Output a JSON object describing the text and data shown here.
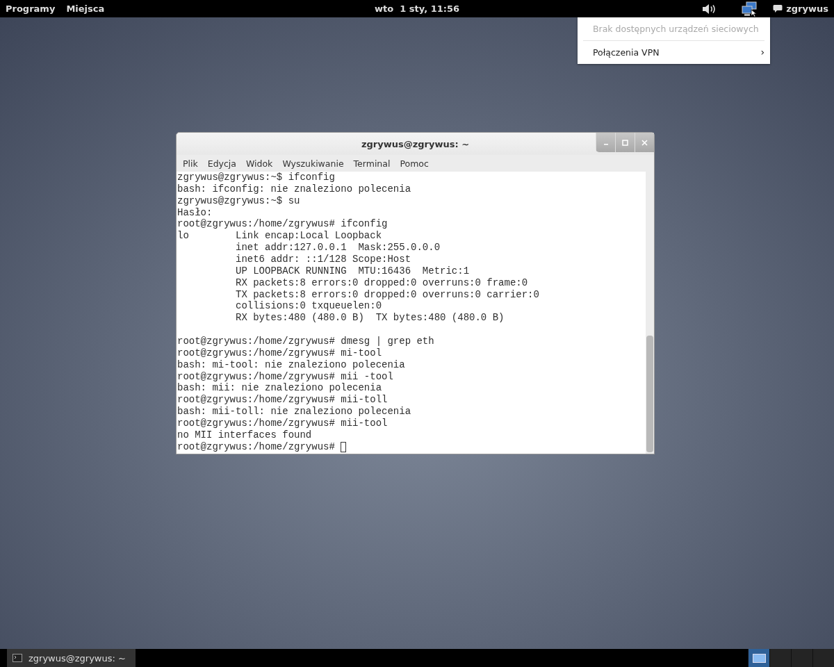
{
  "top_bar": {
    "menus": [
      "Programy",
      "Miejsca"
    ],
    "clock": "wto  1 sty, 11:56",
    "user": "zgrywus"
  },
  "network_menu": {
    "items": [
      {
        "label": "Brak dostępnych urządzeń sieciowych",
        "disabled": true
      },
      {
        "label": "Połączenia VPN",
        "disabled": false,
        "arrow": "›"
      }
    ]
  },
  "window": {
    "title": "zgrywus@zgrywus: ~",
    "menu": [
      "Plik",
      "Edycja",
      "Widok",
      "Wyszukiwanie",
      "Terminal",
      "Pomoc"
    ],
    "output": [
      [
        "zgrywus@zgrywus:~$ ifconfig",
        "bash: ifconfig: nie znaleziono polecenia",
        "zgrywus@zgrywus:~$ su",
        "Hasło:",
        "root@zgrywus:/home/zgrywus# ifconfig",
        "lo        Link encap:Local Loopback",
        "          inet addr:127.0.0.1  Mask:255.0.0.0",
        "          inet6 addr: ::1/128 Scope:Host",
        "          UP LOOPBACK RUNNING  MTU:16436  Metric:1",
        "          RX packets:8 errors:0 dropped:0 overruns:0 frame:0",
        "          TX packets:8 errors:0 dropped:0 overruns:0 carrier:0",
        "          collisions:0 txqueuelen:0",
        "          RX bytes:480 (480.0 B)  TX bytes:480 (480.0 B)"
      ],
      [
        "root@zgrywus:/home/zgrywus# dmesg | grep eth",
        "root@zgrywus:/home/zgrywus# mi-tool",
        "bash: mi-tool: nie znaleziono polecenia",
        "root@zgrywus:/home/zgrywus# mii -tool",
        "bash: mii: nie znaleziono polecenia",
        "root@zgrywus:/home/zgrywus# mii-toll",
        "bash: mii-toll: nie znaleziono polecenia",
        "root@zgrywus:/home/zgrywus# mii-tool",
        "no MII interfaces found",
        "root@zgrywus:/home/zgrywus# "
      ]
    ]
  },
  "taskbar": {
    "tasks": [
      {
        "label": "zgrywus@zgrywus: ~",
        "selected": true
      }
    ],
    "workspaces": [
      {
        "selected": true
      },
      {
        "selected": false
      },
      {
        "selected": false
      },
      {
        "selected": false
      }
    ]
  }
}
